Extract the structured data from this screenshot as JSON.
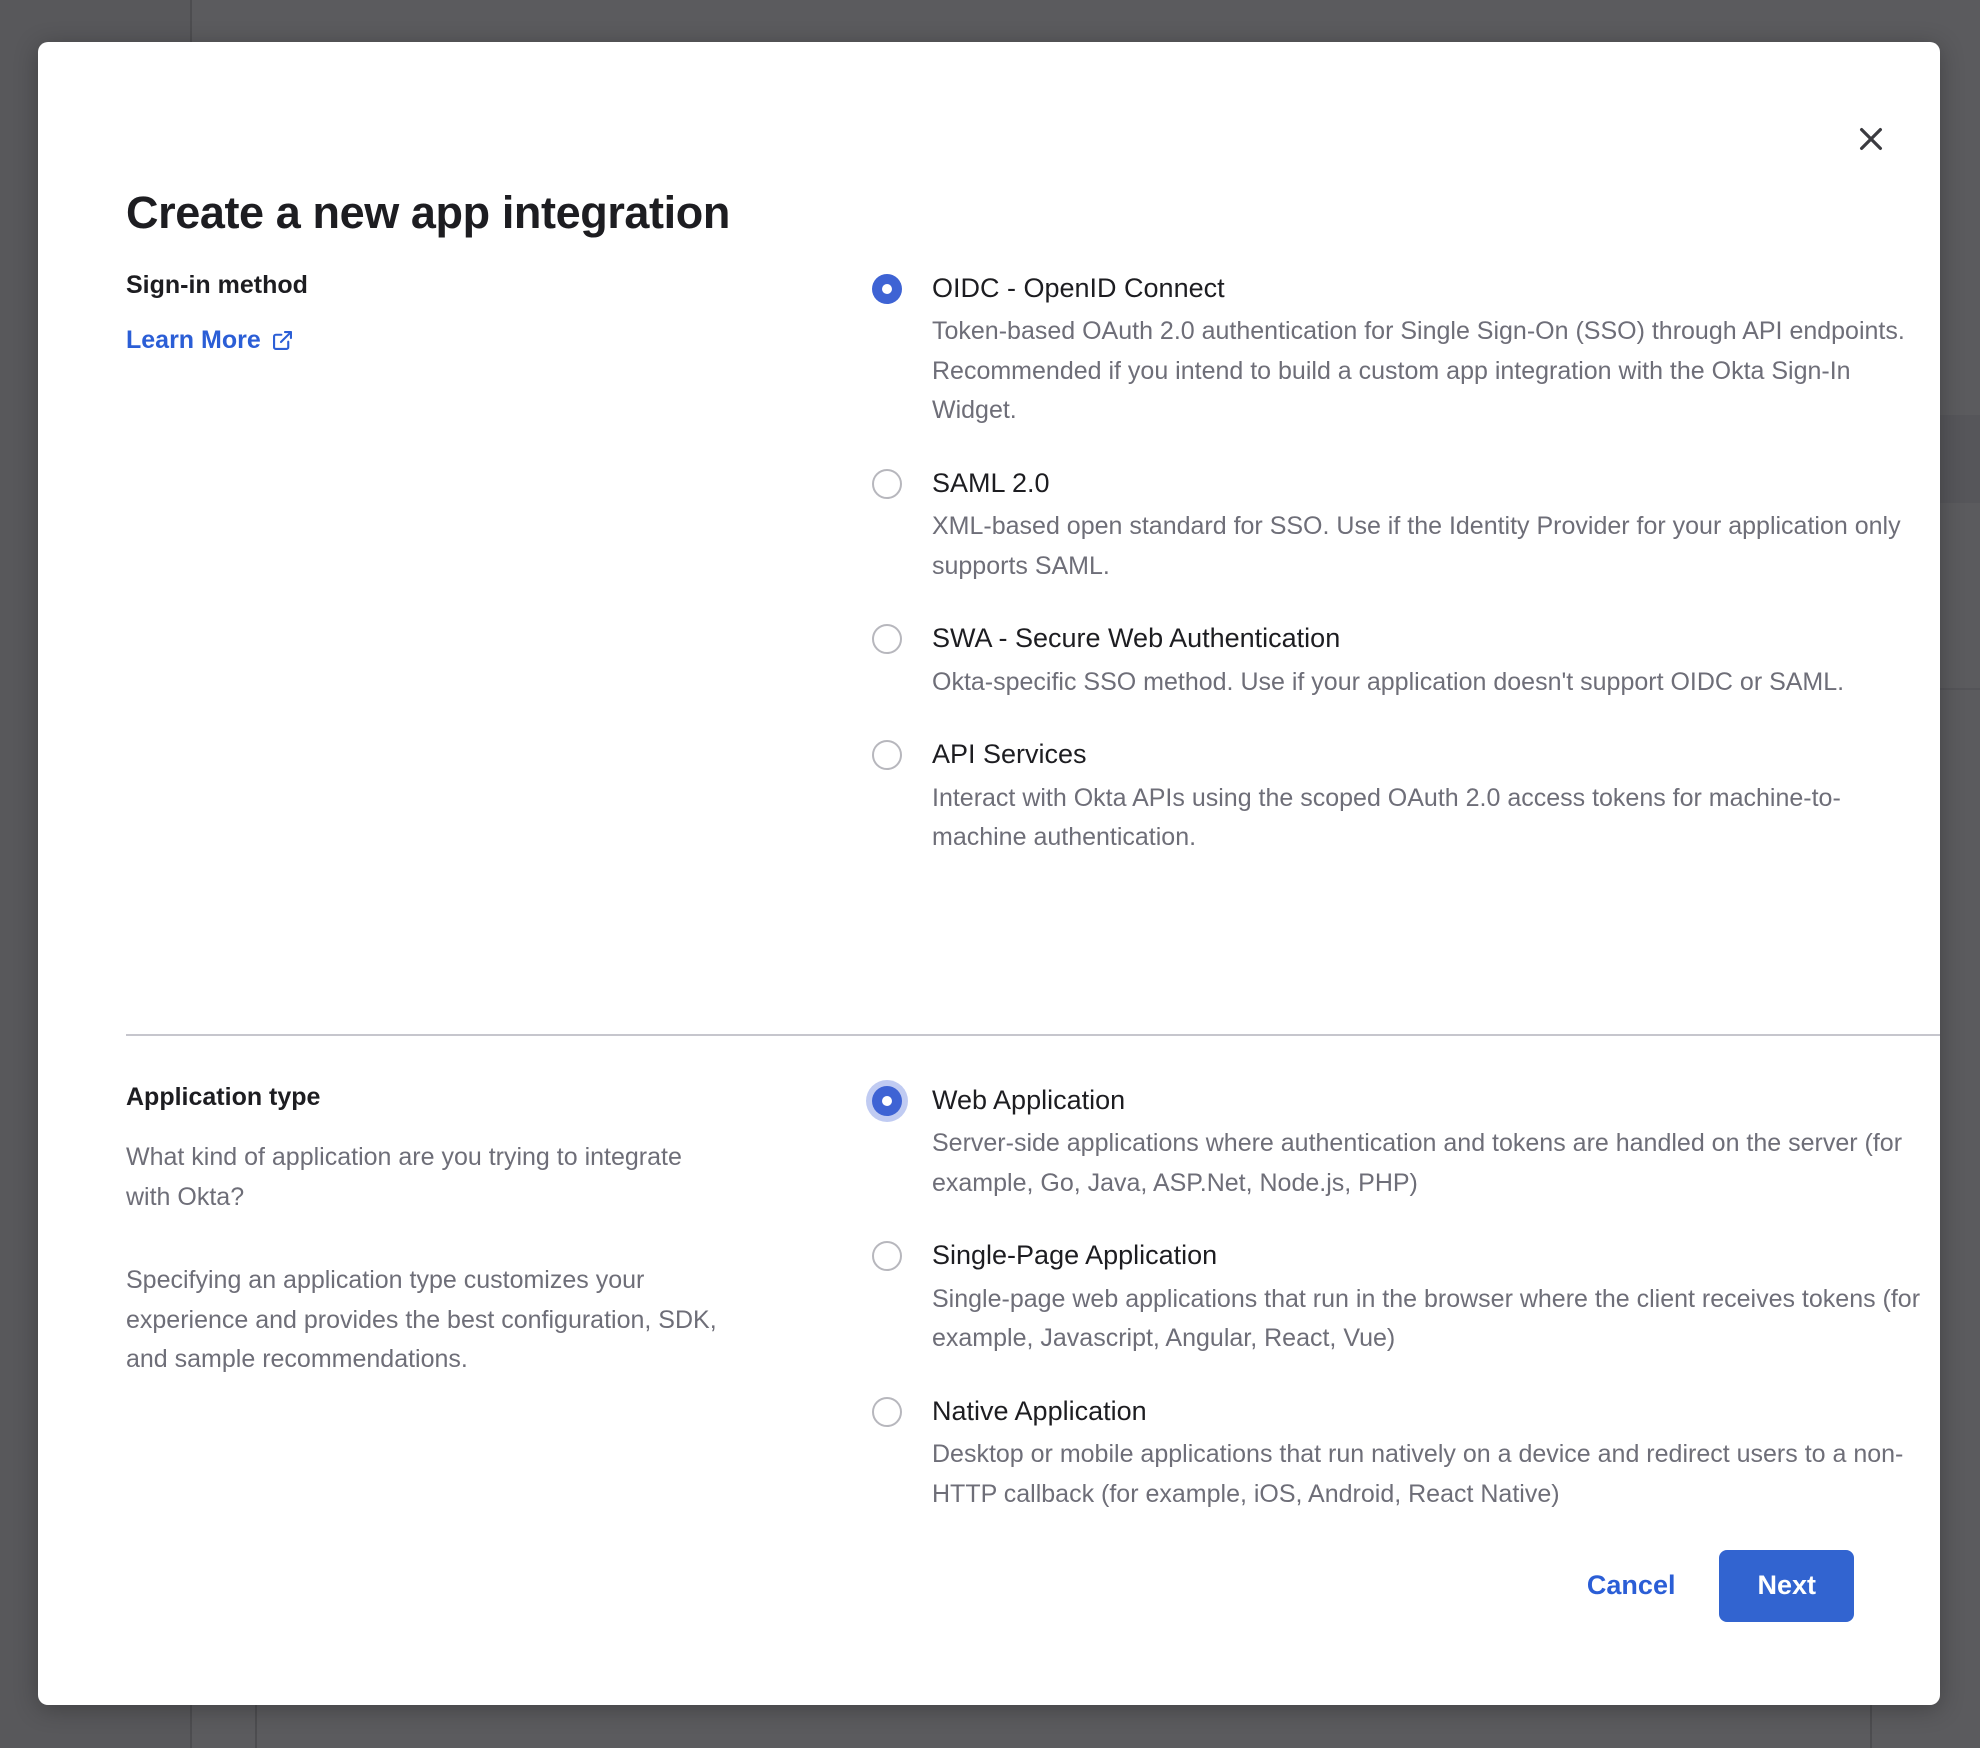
{
  "backdrop": {
    "color": "#5b5b5e"
  },
  "modal": {
    "title": "Create a new app integration",
    "close_icon": "close-icon",
    "accent_color": "#3264d0",
    "link_color": "#2b5ed6"
  },
  "sections": {
    "signin": {
      "heading": "Sign-in method",
      "learn_more_label": "Learn More",
      "learn_more_icon": "external-link-icon",
      "options": [
        {
          "label": "OIDC - OpenID Connect",
          "description": "Token-based OAuth 2.0 authentication for Single Sign-On (SSO) through API endpoints. Recommended if you intend to build a custom app integration with the Okta Sign-In Widget.",
          "selected": true,
          "focused": false
        },
        {
          "label": "SAML 2.0",
          "description": "XML-based open standard for SSO. Use if the Identity Provider for your application only supports SAML.",
          "selected": false,
          "focused": false
        },
        {
          "label": "SWA - Secure Web Authentication",
          "description": "Okta-specific SSO method. Use if your application doesn't support OIDC or SAML.",
          "selected": false,
          "focused": false
        },
        {
          "label": "API Services",
          "description": "Interact with Okta APIs using the scoped OAuth 2.0 access tokens for machine-to-machine authentication.",
          "selected": false,
          "focused": false
        }
      ]
    },
    "apptype": {
      "heading": "Application type",
      "paragraph_1": "What kind of application are you trying to integrate with Okta?",
      "paragraph_2": "Specifying an application type customizes your experience and provides the best configuration, SDK, and sample recommendations.",
      "options": [
        {
          "label": "Web Application",
          "description": "Server-side applications where authentication and tokens are handled on the server (for example, Go, Java, ASP.Net, Node.js, PHP)",
          "selected": true,
          "focused": true
        },
        {
          "label": "Single-Page Application",
          "description": "Single-page web applications that run in the browser where the client receives tokens (for example, Javascript, Angular, React, Vue)",
          "selected": false,
          "focused": false
        },
        {
          "label": "Native Application",
          "description": "Desktop or mobile applications that run natively on a device and redirect users to a non-HTTP callback (for example, iOS, Android, React Native)",
          "selected": false,
          "focused": false
        }
      ]
    }
  },
  "footer": {
    "cancel_label": "Cancel",
    "next_label": "Next"
  }
}
